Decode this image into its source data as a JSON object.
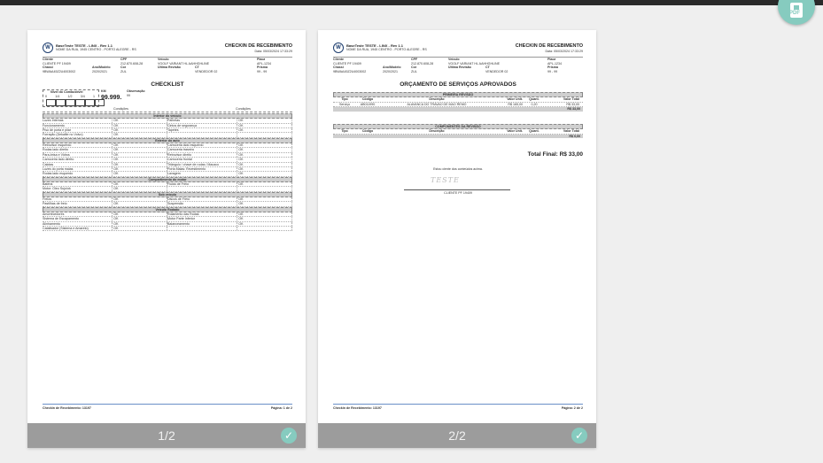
{
  "pdf_button": {
    "label": "PDF",
    "icon": "pdf-file-icon"
  },
  "header": {
    "company_name": "BaseTeste TESTE - LINX - Rev 1.1",
    "company_address": "NOME DA RUA, 1945 CENTRO - PORTO ALEGRE - RS",
    "doc_title": "CHECKIN DE RECEBIMENTO",
    "date": "Data: 05/03/2024 17:33:29",
    "labels": {
      "cliente": "Cliente",
      "cpf": "CPF",
      "veiculo": "Veículo",
      "placa": "Placa",
      "chassi": "Chassi",
      "ano_modelo": "Ano/Modelo",
      "cor": "Cor",
      "ultima_revisao": "Última Revisão",
      "ct": "CT",
      "prisma": "Prisma"
    },
    "values": {
      "cliente": "CLIENTE PF 19409",
      "cpf": "212.870.608-28",
      "veiculo": "VGOLF VARIANT HL AAHHGHLINE",
      "placa": "APL-1234",
      "chassi": "9BWAA45Z2U4003002",
      "ano_modelo": "2020/2021",
      "cor": "ZUL",
      "ultima_revisao": "",
      "ct": "VENDEDOR 02",
      "prisma": "99 - 99"
    }
  },
  "page1": {
    "title": "CHECKLIST",
    "fuel_label": "Nível do Combustível",
    "fuel_scale": [
      "0",
      "1/4",
      "1/2",
      "3/4",
      "1"
    ],
    "km_label": "KM",
    "km_value": "99.999.",
    "obs_label": "Observação",
    "obs_value": "99",
    "cond_label": "Condições",
    "sections": [
      {
        "title": "Interior do veículo",
        "rows": [
          [
            "Luzes Internas",
            "OK",
            "Palhetas",
            "OK"
          ],
          [
            "Funcionamento",
            "OK",
            "Cintos de segurança",
            "OK"
          ],
          [
            "Piso de porta e pilar",
            "OK",
            "Tapetes",
            "OK"
          ],
          [
            "Forração (Dekalite no Volvo)",
            "OK",
            "",
            ""
          ]
        ]
      },
      {
        "title": "Exterior do auto",
        "rows": [
          [
            "Retrovisor esquerdo",
            "OK",
            "Carroceria lado esquerdo",
            "OK"
          ],
          [
            "Rodas lado direito",
            "OK",
            "Carroceria traseira",
            "OK"
          ],
          [
            "Para-brisa e Vidros",
            "OK",
            "Retrovisor direito",
            "OK"
          ],
          [
            "Carroceria lado direito",
            "OK",
            "Carroceria frontal",
            "OK"
          ],
          [
            "Calotas",
            "OK",
            "Triângulo / chave de rodas / Macaco",
            "OK"
          ],
          [
            "Luzes do porta malas",
            "OK",
            "Porta Malas: Revestimento",
            "OK"
          ],
          [
            "Rodas lado esquerdo",
            "OK",
            "Lavagem",
            "OK"
          ]
        ]
      },
      {
        "title": "Compartimento do motor",
        "rows": [
          [
            "Bateria",
            "OK",
            "Fluido de Freio",
            "OK"
          ],
          [
            "Motor: Óleo Sujo/ok",
            "OK",
            "",
            ""
          ]
        ]
      },
      {
        "title": "Sob veículo",
        "rows": [
          [
            "Freios",
            "OK",
            "Discos de Freio",
            "OK"
          ],
          [
            "Pastilhas de freio",
            "OK",
            "Suspensão",
            "OK"
          ]
        ]
      },
      {
        "title": "Veículo Rodado",
        "rows": [
          [
            "Amortecedores",
            "OK",
            "Rolamento das Rodas",
            "OK"
          ],
          [
            "Sistema de Escapamento",
            "OK",
            "Motor Parte Inferior",
            "OK"
          ],
          [
            "Alinhamento",
            "OK",
            "Balanceamento",
            "OK"
          ],
          [
            "Catalisador (Sistema e Amarelo)",
            "OK",
            "",
            ""
          ]
        ]
      }
    ],
    "footer_left": "Checkin de Recebimento: 13197",
    "footer_right": "Página: 1 de 2",
    "page_indicator": "1/2"
  },
  "page2": {
    "title": "ORÇAMENTO DE SERVIÇOS APROVADOS",
    "section1_title": "PRIMEIRA REVISÃO",
    "section2_title": "COMPONENTES DA REVISÃO",
    "columns": [
      "Tipo",
      "Código",
      "Descrição",
      "Valor Unit.",
      "Quant.",
      "Valor Total"
    ],
    "rows": [
      [
        "Serviço",
        "AB011990",
        "ALAVANCA DO TRAVAO DE MAO REMO",
        "R$ 165,00",
        "0,20",
        "R$ 33,00"
      ]
    ],
    "subtotal1": "R$ 33,00",
    "subtotal2": "R$ 0,00",
    "total": "Total Final: R$ 33,00",
    "ack": "Estou ciente dos conteúdos acima.",
    "signature": "TESTE",
    "signer": "CLIENTE PF 19409",
    "footer_left": "Checkin de Recebimento: 13197",
    "footer_right": "Página: 2 de 2",
    "page_indicator": "2/2"
  },
  "colors": {
    "accent": "#86cbbf",
    "footer_bar": "#9c9c9c",
    "background": "#efefef",
    "topbar": "#2a2a2a"
  }
}
